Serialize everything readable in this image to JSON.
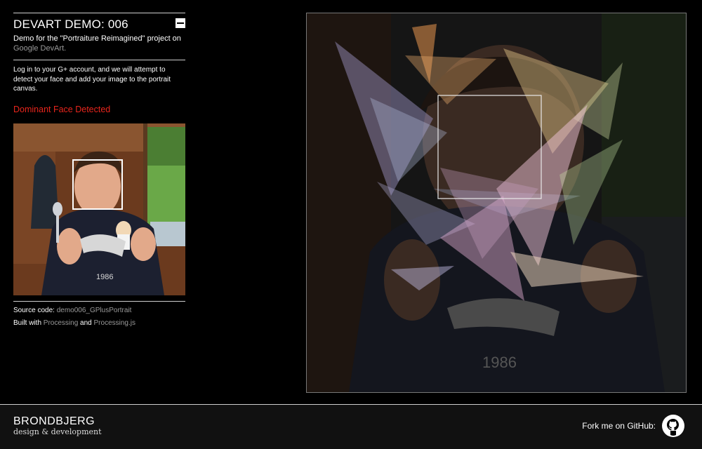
{
  "sidebar": {
    "title": "DEVART DEMO: 006",
    "subtitle_text": "Demo for the \"Portraiture Reimagined\" project on",
    "subtitle_link": "Google DevArt.",
    "description": "Log in to your G+ account, and we will attempt to detect your face and add your image to the portrait canvas.",
    "status": "Dominant Face Detected",
    "source_label": "Source code:",
    "source_link": "demo006_GPlusPortrait",
    "built_label": "Built with",
    "built_link1": "Processing",
    "built_and": "and",
    "built_link2": "Processing.js"
  },
  "footer": {
    "brand_name": "BRONDBJERG",
    "brand_tag": "design & development",
    "fork_label": "Fork me on GitHub:"
  },
  "colors": {
    "alert": "#e8251c",
    "link": "#9a9a9a",
    "background": "#000000"
  },
  "icons": {
    "minimize": "minimize-icon",
    "github": "github-icon"
  }
}
